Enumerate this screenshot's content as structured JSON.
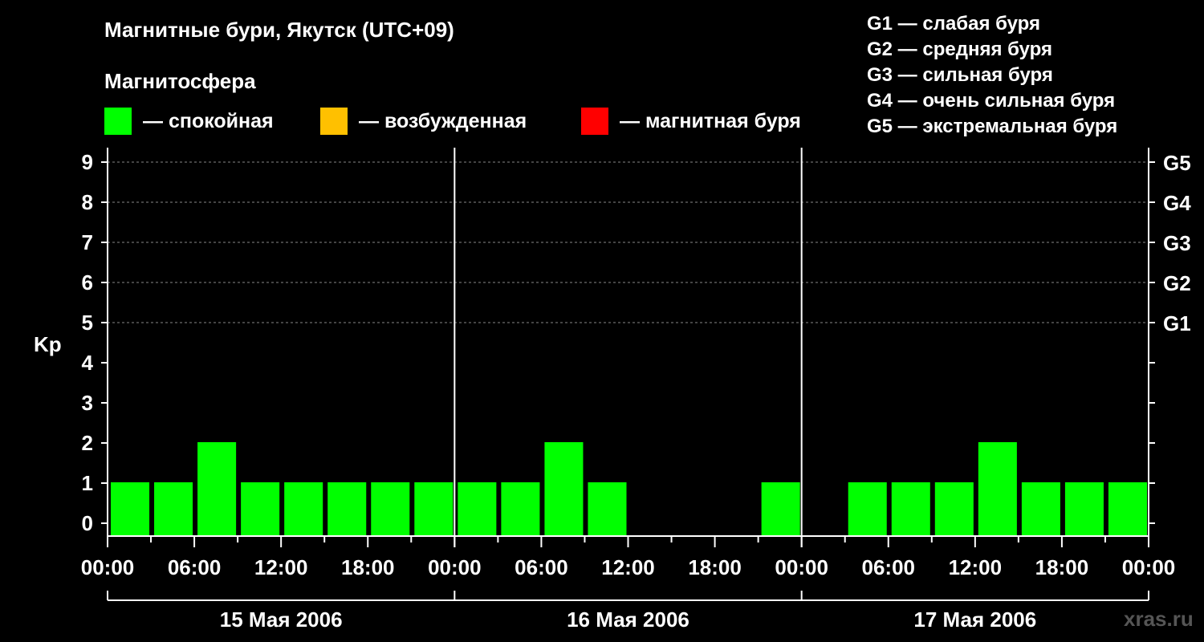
{
  "title": "Магнитные бури, Якутск (UTC+09)",
  "subtitle": "Магнитосфера",
  "legend": [
    {
      "label": "— спокойная",
      "color": "#00ff00"
    },
    {
      "label": "— возбужденная",
      "color": "#ffc000"
    },
    {
      "label": "— магнитная буря",
      "color": "#ff0000"
    }
  ],
  "g_levels": [
    "G1 — слабая буря",
    "G2 — средняя буря",
    "G3 — сильная буря",
    "G4 — очень сильная буря",
    "G5 — экстремальная буря"
  ],
  "watermark": "xras.ru",
  "chart_data": {
    "type": "bar",
    "ylabel": "Kp",
    "ylim": [
      0,
      9
    ],
    "yticks": [
      "0",
      "1",
      "2",
      "3",
      "4",
      "5",
      "6",
      "7",
      "8",
      "9"
    ],
    "right_ticks": [
      {
        "kp": 5,
        "label": "G1"
      },
      {
        "kp": 6,
        "label": "G2"
      },
      {
        "kp": 7,
        "label": "G3"
      },
      {
        "kp": 8,
        "label": "G4"
      },
      {
        "kp": 9,
        "label": "G5"
      }
    ],
    "x_tick_labels": [
      "00:00",
      "06:00",
      "12:00",
      "18:00",
      "00:00",
      "06:00",
      "12:00",
      "18:00",
      "00:00",
      "06:00",
      "12:00",
      "18:00",
      "00:00"
    ],
    "days": [
      "15 Мая 2006",
      "16 Мая 2006",
      "17 Мая 2006"
    ],
    "interval_hours": 3,
    "values": [
      1,
      1,
      2,
      1,
      1,
      1,
      1,
      1,
      1,
      1,
      2,
      1,
      null,
      null,
      null,
      1,
      null,
      1,
      1,
      1,
      2,
      1,
      1,
      1
    ],
    "bar_color": "#00ff00",
    "grid": "dashed at Kp 5-9"
  }
}
